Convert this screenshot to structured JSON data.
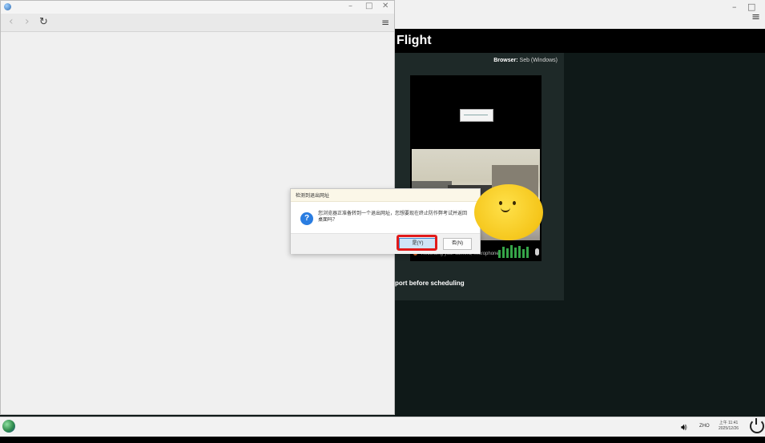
{
  "back_window": {
    "header_title": "Flight",
    "browser_label": "Browser:",
    "browser_value": "Seb (Windows)",
    "recording_text": "Recording your camera, microphone",
    "passport_text": "port before scheduling",
    "menu_icon": "hamburger-menu-icon"
  },
  "front_window": {
    "nav": {
      "back_icon": "chevron-left-icon",
      "forward_icon": "chevron-right-icon",
      "reload_icon": "reload-icon",
      "menu_icon": "hamburger-menu-icon"
    }
  },
  "dialog": {
    "title": "检测到退出网址",
    "message": "您浏览器正准备转到一个退出网址，您想要现在终止防作弊考试并返回桌面吗？",
    "yes_label": "是(Y)",
    "no_label": "否(N)",
    "icon": "question-icon"
  },
  "taskbar": {
    "language": "ZHO",
    "time": "上午 11:41",
    "date": "2025/12/26",
    "volume_icon": "volume-icon",
    "power_icon": "power-icon",
    "start_icon": "start-icon"
  },
  "colors": {
    "highlight": "#e11b1b",
    "accent_blue": "#2a7de1",
    "dark_bg": "#0f1918",
    "card_bg": "#1e2928",
    "mascot_yellow": "#f5c61b"
  }
}
